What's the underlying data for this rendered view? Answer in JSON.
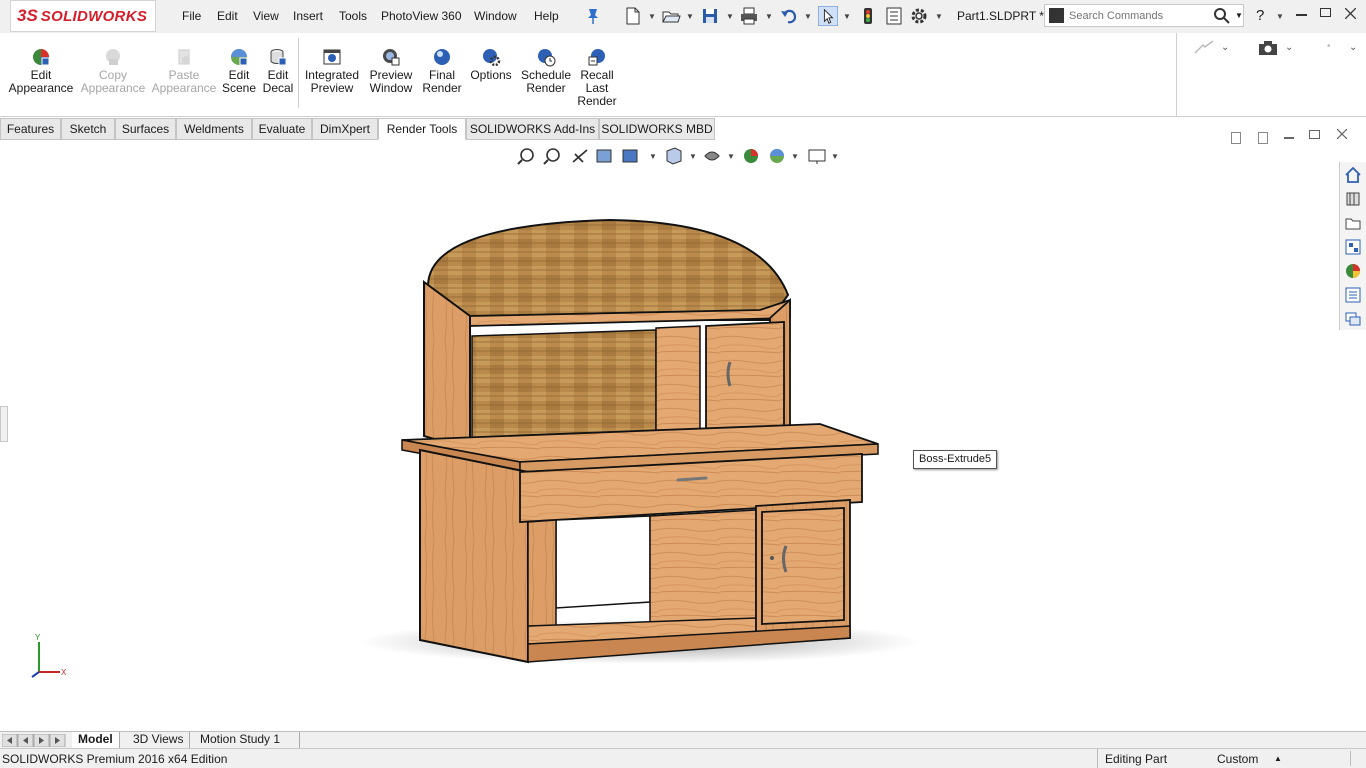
{
  "app": {
    "logo_text": "SOLIDWORKS",
    "logo_mark": "3S",
    "doc_title": "Part1.SLDPRT *"
  },
  "menu": [
    "File",
    "Edit",
    "View",
    "Insert",
    "Tools",
    "PhotoView 360",
    "Window",
    "Help"
  ],
  "search": {
    "placeholder": "Search Commands",
    "help_glyph": "?"
  },
  "commands": [
    {
      "line1": "Edit",
      "line2": "Appearance",
      "line3": "",
      "enabled": true,
      "icon": "edit-appearance-icon"
    },
    {
      "line1": "Copy",
      "line2": "Appearance",
      "line3": "",
      "enabled": false,
      "icon": "copy-appearance-icon"
    },
    {
      "line1": "Paste",
      "line2": "Appearance",
      "line3": "",
      "enabled": false,
      "icon": "paste-appearance-icon"
    },
    {
      "line1": "Edit",
      "line2": "Scene",
      "line3": "",
      "enabled": true,
      "icon": "edit-scene-icon"
    },
    {
      "line1": "Edit",
      "line2": "Decal",
      "line3": "",
      "enabled": true,
      "icon": "edit-decal-icon"
    },
    {
      "line1": "Integrated",
      "line2": "Preview",
      "line3": "",
      "enabled": true,
      "icon": "integrated-preview-icon"
    },
    {
      "line1": "Preview",
      "line2": "Window",
      "line3": "",
      "enabled": true,
      "icon": "preview-window-icon"
    },
    {
      "line1": "Final",
      "line2": "Render",
      "line3": "",
      "enabled": true,
      "icon": "final-render-icon"
    },
    {
      "line1": "Options",
      "line2": "",
      "line3": "",
      "enabled": true,
      "icon": "options-icon"
    },
    {
      "line1": "Schedule",
      "line2": "Render",
      "line3": "",
      "enabled": true,
      "icon": "schedule-render-icon"
    },
    {
      "line1": "Recall",
      "line2": "Last",
      "line3": "Render",
      "enabled": true,
      "icon": "recall-last-render-icon"
    }
  ],
  "tabs": [
    {
      "label": "Features",
      "active": false
    },
    {
      "label": "Sketch",
      "active": false
    },
    {
      "label": "Surfaces",
      "active": false
    },
    {
      "label": "Weldments",
      "active": false
    },
    {
      "label": "Evaluate",
      "active": false
    },
    {
      "label": "DimXpert",
      "active": false
    },
    {
      "label": "Render Tools",
      "active": true
    },
    {
      "label": "SOLIDWORKS Add-Ins",
      "active": false
    },
    {
      "label": "SOLIDWORKS MBD",
      "active": false
    }
  ],
  "viewport": {
    "tooltip": "Boss-Extrude5",
    "triad_y": "Y",
    "triad_x": "X"
  },
  "bottom_tabs": [
    {
      "label": "Model",
      "active": true
    },
    {
      "label": "3D Views",
      "active": false
    },
    {
      "label": "Motion Study 1",
      "active": false
    }
  ],
  "status": {
    "edition": "SOLIDWORKS Premium 2016 x64 Edition",
    "mode": "Editing Part",
    "units": "Custom"
  },
  "colors": {
    "brand": "#d41e2a",
    "wood_light": "#e6ab78",
    "wood_dark": "#b97b3e",
    "active_tab_bg": "#ffffff"
  }
}
